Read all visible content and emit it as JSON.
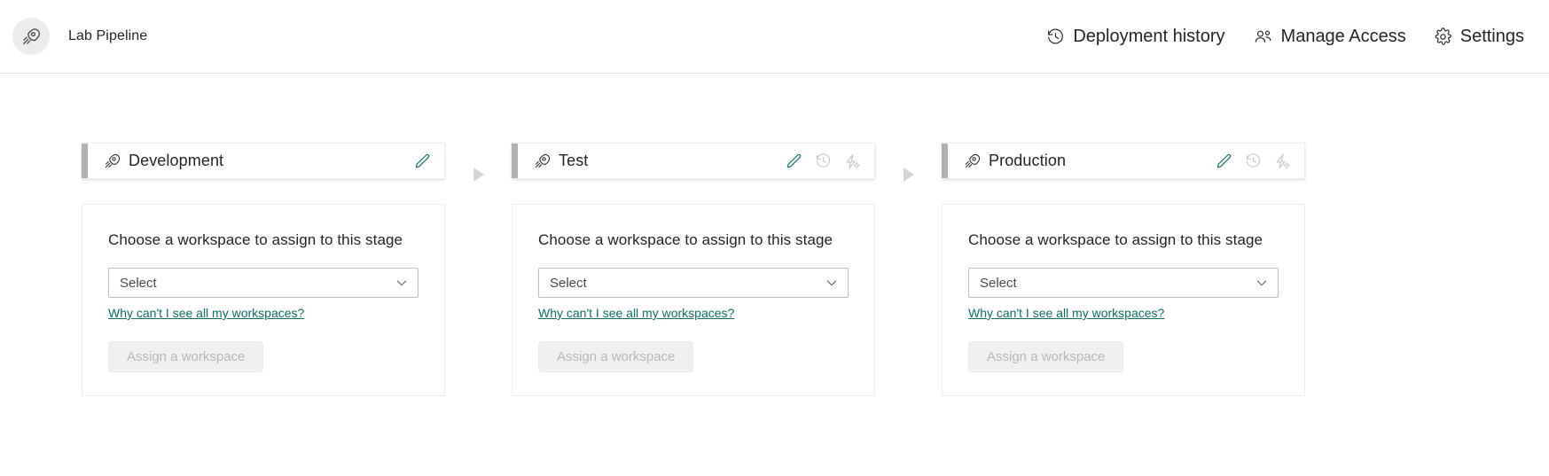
{
  "header": {
    "avatar_icon": "rocket-icon",
    "title": "Lab Pipeline",
    "actions": [
      {
        "label": "Deployment history",
        "icon": "history-icon"
      },
      {
        "label": "Manage Access",
        "icon": "people-icon"
      },
      {
        "label": "Settings",
        "icon": "gear-icon"
      }
    ]
  },
  "colors": {
    "accent_teal": "#0f6c63",
    "stage_accent_bar": "#b3b0ad",
    "disabled_gray": "#b8b8b8",
    "connector_gray": "#d4d4d4"
  },
  "card_labels": {
    "heading": "Choose a workspace to assign to this stage",
    "select_value": "Select",
    "select_placeholder": "Select",
    "help_link": "Why can't I see all my workspaces?",
    "assign_button": "Assign a workspace"
  },
  "connector_icon": "triangle-right-icon",
  "stages": [
    {
      "name": "Development",
      "icon": "rocket-icon",
      "tools": [
        {
          "name": "edit-icon",
          "enabled": true
        }
      ]
    },
    {
      "name": "Test",
      "icon": "rocket-icon",
      "tools": [
        {
          "name": "edit-icon",
          "enabled": true
        },
        {
          "name": "history-icon",
          "enabled": false
        },
        {
          "name": "deployment-settings-icon",
          "enabled": false
        }
      ]
    },
    {
      "name": "Production",
      "icon": "rocket-icon",
      "tools": [
        {
          "name": "edit-icon",
          "enabled": true
        },
        {
          "name": "history-icon",
          "enabled": false
        },
        {
          "name": "deployment-settings-icon",
          "enabled": false
        }
      ]
    }
  ]
}
